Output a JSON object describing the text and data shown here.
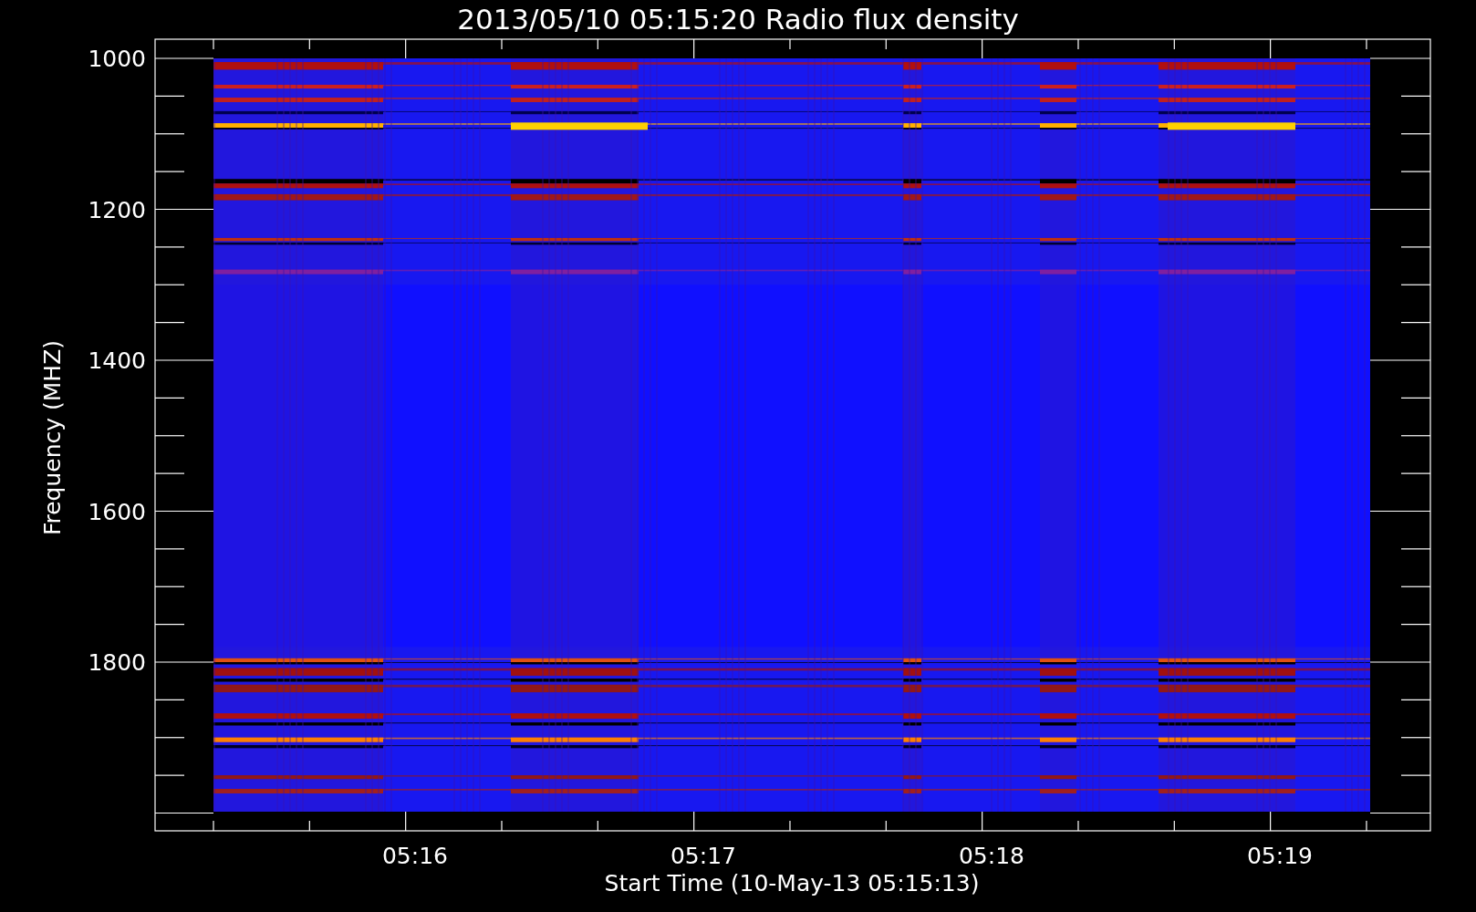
{
  "title": "2013/05/10 05:15:20 Radio flux density",
  "y_axis": {
    "label": "Frequency (MHZ)",
    "ticks": [
      "1000",
      "1200",
      "1400",
      "1600",
      "1800"
    ]
  },
  "x_axis": {
    "label": "Start Time (10-May-13 05:15:13)",
    "ticks": [
      "05:16",
      "05:17",
      "05:18",
      "05:19"
    ]
  }
}
